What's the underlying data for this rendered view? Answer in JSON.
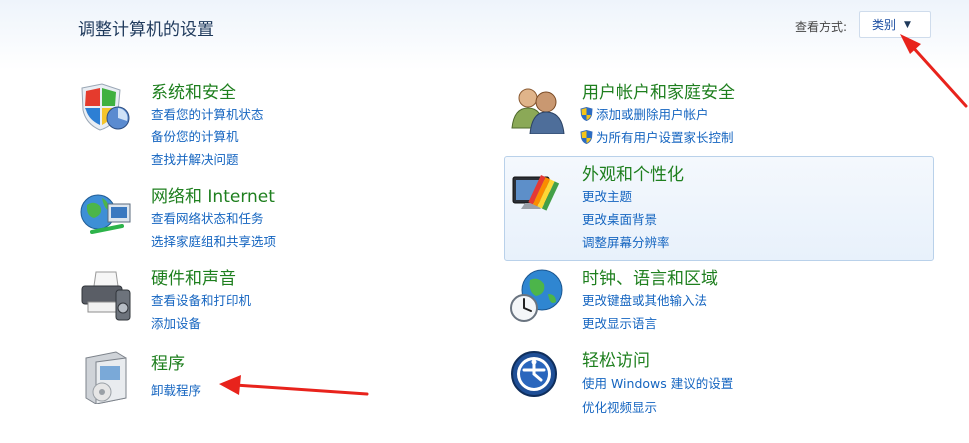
{
  "header": {
    "title": "调整计算机的设置",
    "view_label": "查看方式:",
    "view_value": "类别"
  },
  "categories": {
    "system": {
      "title": "系统和安全",
      "links": [
        "查看您的计算机状态",
        "备份您的计算机",
        "查找并解决问题"
      ]
    },
    "network": {
      "title": "网络和 Internet",
      "links": [
        "查看网络状态和任务",
        "选择家庭组和共享选项"
      ]
    },
    "hardware": {
      "title": "硬件和声音",
      "links": [
        "查看设备和打印机",
        "添加设备"
      ]
    },
    "programs": {
      "title": "程序",
      "links": [
        "卸载程序"
      ]
    },
    "users": {
      "title": "用户帐户和家庭安全",
      "links": [
        "添加或删除用户帐户",
        "为所有用户设置家长控制"
      ]
    },
    "appearance": {
      "title": "外观和个性化",
      "links": [
        "更改主题",
        "更改桌面背景",
        "调整屏幕分辨率"
      ]
    },
    "clock": {
      "title": "时钟、语言和区域",
      "links": [
        "更改键盘或其他输入法",
        "更改显示语言"
      ]
    },
    "ease": {
      "title": "轻松访问",
      "links": [
        "使用 Windows 建议的设置",
        "优化视频显示"
      ]
    }
  },
  "colors": {
    "title_green": "#1e7f1e",
    "link_blue": "#1565c0",
    "arrow_red": "#e8231c"
  },
  "icons": {
    "system": "shield-icon",
    "network": "network-globe-icon",
    "hardware": "printer-icon",
    "programs": "program-box-icon",
    "users": "users-icon",
    "appearance": "monitor-palette-icon",
    "clock": "globe-clock-icon",
    "ease": "ease-of-access-icon",
    "uac": "uac-shield-icon"
  }
}
